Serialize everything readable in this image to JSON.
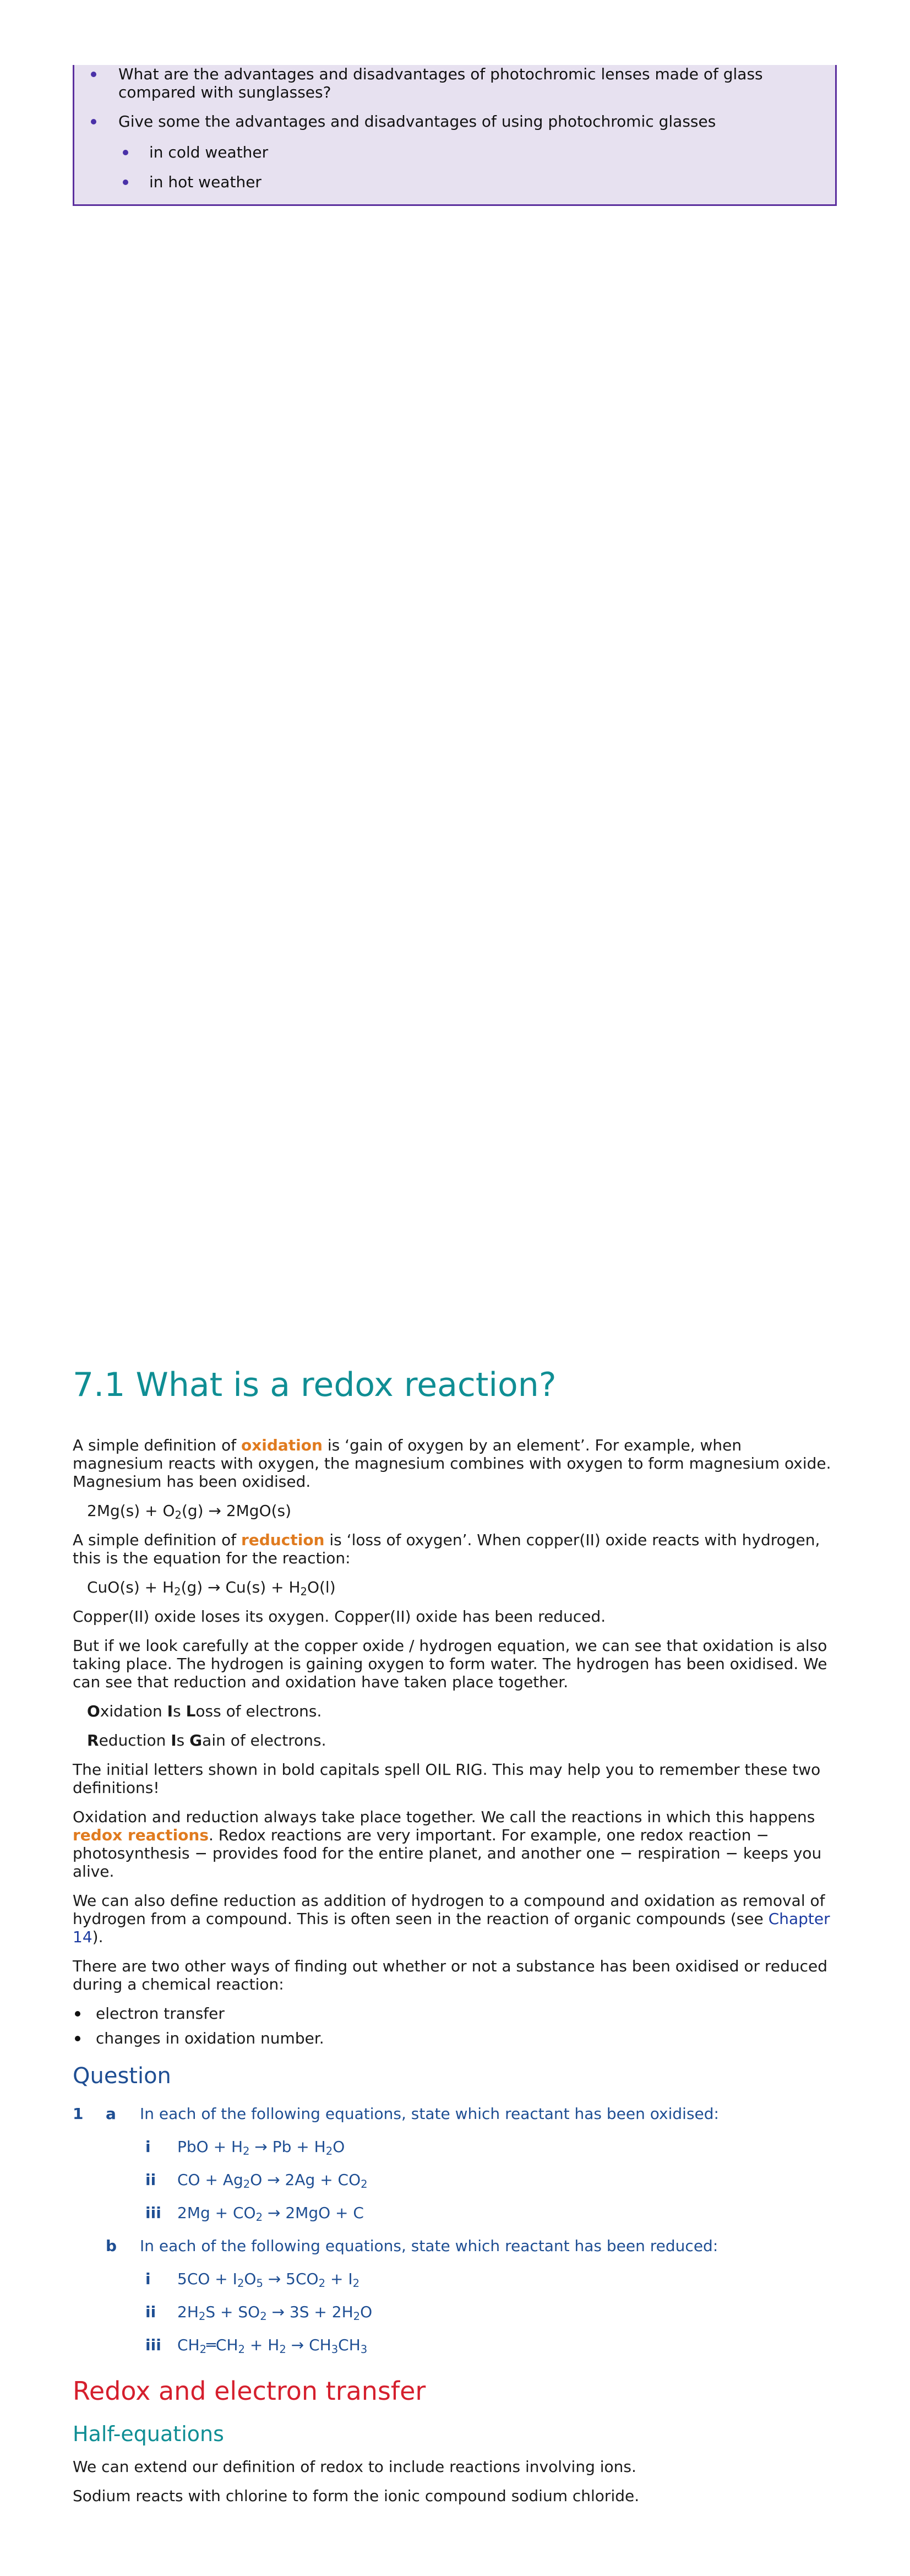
{
  "question_box": {
    "items": [
      {
        "text": "What are the advantages and disadvantages of photochromic lenses made of glass compared with sunglasses?",
        "level": 1
      },
      {
        "text": "Give some the advantages and disadvantages of using photochromic glasses",
        "level": 1
      },
      {
        "text": "in cold weather",
        "level": 2
      },
      {
        "text": "in hot weather",
        "level": 2
      }
    ]
  },
  "section": {
    "title": "7.1 What is a redox reaction?",
    "p1_before": "A simple definition of ",
    "p1_term": "oxidation",
    "p1_after": " is ‘gain of oxygen by an element’. For example, when magnesium reacts with oxygen, the magnesium combines with oxygen to form magnesium oxide. Magnesium has been oxidised.",
    "eq1": [
      "2Mg(s) + O",
      "2",
      "(g) → 2MgO(s)"
    ],
    "p2_before": "A simple definition of ",
    "p2_term": "reduction",
    "p2_after": " is ‘loss of oxygen’. When copper(II) oxide reacts with hydrogen, this is the equation for the reaction:",
    "eq2": [
      "CuO(s) + H",
      "2",
      "(g) → Cu(s) + H",
      "2",
      "O(l)"
    ],
    "p3": "Copper(II) oxide loses its oxygen. Copper(II) oxide has been reduced.",
    "p4": "But if we look carefully at the copper oxide / hydrogen equation, we can see that oxidation is also taking place. The hydrogen is gaining oxygen to form water. The hydrogen has been oxidised. We can see that reduction and oxidation have taken place together.",
    "mnemonic1": [
      "O",
      "xidation ",
      "I",
      "s ",
      "L",
      "oss of electrons."
    ],
    "mnemonic2": [
      "R",
      "eduction ",
      "I",
      "s ",
      "G",
      "ain of electrons."
    ],
    "p5": "The initial letters shown in bold capitals spell OIL RIG. This may help you to remember these two definitions!",
    "p6_before": "Oxidation and reduction always take place together. We call the reactions in which this happens ",
    "p6_term": "redox reactions",
    "p6_after": ". Redox reactions are very important. For example, one redox reaction − photosynthesis − provides food for the entire planet, and another one − respiration − keeps you alive.",
    "p7_before": "We can also define reduction as addition of hydrogen to a compound and oxidation as removal of hydrogen from a compound. This is often seen in the reaction of organic compounds (see ",
    "p7_link": "Chapter 14",
    "p7_after": ").",
    "p8": "There are two other ways of finding out whether or not a substance has been oxidised or reduced during a chemical reaction:",
    "bullets": [
      "electron transfer",
      "changes in oxidation number."
    ]
  },
  "question": {
    "heading": "Question",
    "number": "1",
    "part_a": {
      "letter": "a",
      "text": "In each of the following equations, state which reactant has been oxidised:",
      "items": [
        {
          "roman": "i",
          "eq": [
            "PbO + H",
            "2",
            " → Pb + H",
            "2",
            "O"
          ]
        },
        {
          "roman": "ii",
          "eq": [
            "CO + Ag",
            "2",
            "O → 2Ag + CO",
            "2",
            ""
          ]
        },
        {
          "roman": "iii",
          "eq": [
            "2Mg + CO",
            "2",
            " → 2MgO + C",
            "",
            ""
          ]
        }
      ]
    },
    "part_b": {
      "letter": "b",
      "text": "In each of the following equations, state which reactant has been reduced:",
      "items": [
        {
          "roman": "i",
          "eq": [
            "5CO + I",
            "2",
            "O",
            "5",
            " → 5CO",
            "2",
            " + I",
            "2",
            ""
          ]
        },
        {
          "roman": "ii",
          "eq": [
            "2H",
            "2",
            "S + SO",
            "2",
            " → 3S + 2H",
            "2",
            "O"
          ]
        },
        {
          "roman": "iii",
          "eq": [
            "CH",
            "2",
            "═CH",
            "2",
            " + H",
            "2",
            " → CH",
            "3",
            "CH",
            "3",
            ""
          ]
        }
      ]
    }
  },
  "redox_section": {
    "title": "Redox and electron transfer",
    "subtitle": "Half-equations",
    "p1": "We can extend our definition of redox to include reactions involving ions.",
    "p2": "Sodium reacts with chlorine to form the ionic compound sodium chloride."
  },
  "colors": {
    "section_title": "#0f8e94",
    "keyword": "#e07b1f",
    "question": "#1e4e93",
    "red_heading": "#d51f2d",
    "box_bg": "#e7e1f0",
    "box_border": "#5b2f9e"
  }
}
